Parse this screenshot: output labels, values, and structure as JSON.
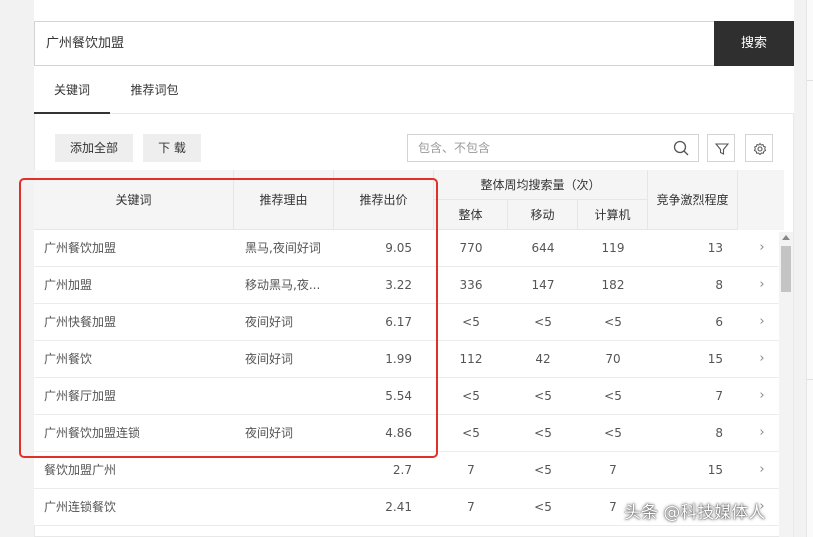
{
  "search": {
    "value": "广州餐饮加盟",
    "button_label": "搜索"
  },
  "tabs": [
    {
      "label": "关键词",
      "active": true
    },
    {
      "label": "推荐词包",
      "active": false
    }
  ],
  "toolbar": {
    "add_all_label": "添加全部",
    "download_label": "下 载",
    "filter_placeholder": "包含、不包含"
  },
  "table": {
    "headers": {
      "keyword": "关键词",
      "reason": "推荐理由",
      "bid": "推荐出价",
      "search_volume": "整体周均搜索量（次）",
      "total": "整体",
      "mobile": "移动",
      "pc": "计算机",
      "competition": "竞争激烈程度"
    },
    "rows": [
      {
        "keyword": "广州餐饮加盟",
        "reason": "黑马,夜间好词",
        "bid": "9.05",
        "total": "770",
        "mobile": "644",
        "pc": "119",
        "competition": "13"
      },
      {
        "keyword": "广州加盟",
        "reason": "移动黑马,夜...",
        "bid": "3.22",
        "total": "336",
        "mobile": "147",
        "pc": "182",
        "competition": "8"
      },
      {
        "keyword": "广州快餐加盟",
        "reason": "夜间好词",
        "bid": "6.17",
        "total": "<5",
        "mobile": "<5",
        "pc": "<5",
        "competition": "6"
      },
      {
        "keyword": "广州餐饮",
        "reason": "夜间好词",
        "bid": "1.99",
        "total": "112",
        "mobile": "42",
        "pc": "70",
        "competition": "15"
      },
      {
        "keyword": "广州餐厅加盟",
        "reason": "",
        "bid": "5.54",
        "total": "<5",
        "mobile": "<5",
        "pc": "<5",
        "competition": "7"
      },
      {
        "keyword": "广州餐饮加盟连锁",
        "reason": "夜间好词",
        "bid": "4.86",
        "total": "<5",
        "mobile": "<5",
        "pc": "<5",
        "competition": "8"
      },
      {
        "keyword": "餐饮加盟广州",
        "reason": "",
        "bid": "2.7",
        "total": "7",
        "mobile": "<5",
        "pc": "7",
        "competition": "15"
      },
      {
        "keyword": "广州连锁餐饮",
        "reason": "",
        "bid": "2.41",
        "total": "7",
        "mobile": "<5",
        "pc": "7",
        "competition": ""
      }
    ]
  },
  "watermark": "头条 @科技媒体人",
  "colors": {
    "search_button": "#2f2f2f",
    "highlight_border": "#e0302a",
    "header_bg": "#f5f5f5"
  }
}
